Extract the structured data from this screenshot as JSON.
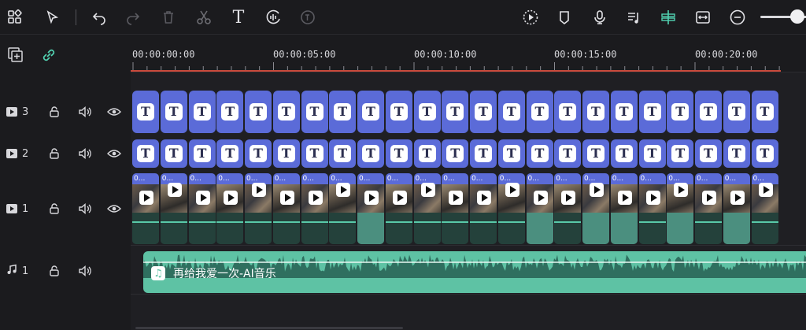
{
  "toolbar": {
    "left_icons": [
      "layout-grid-icon",
      "select-arrow-icon",
      "undo-icon",
      "redo-icon",
      "delete-icon",
      "cut-icon",
      "text-icon",
      "audio-sync-icon",
      "text-to-speech-icon"
    ],
    "right_icons": [
      "render-preview-icon",
      "marker-icon",
      "microphone-icon",
      "audio-mixer-icon",
      "snap-icon",
      "fit-icon",
      "zoom-out-icon"
    ],
    "zoom_level": 0.7
  },
  "timeline": {
    "ruler_labels": [
      "00:00:00:00",
      "00:00:05:00",
      "00:00:10:00",
      "00:00:15:00",
      "00:00:20:00"
    ]
  },
  "tracks": [
    {
      "kind": "video",
      "label": "3"
    },
    {
      "kind": "video",
      "label": "2"
    },
    {
      "kind": "video",
      "label": "1"
    },
    {
      "kind": "audio",
      "label": "1"
    }
  ],
  "title_clip_glyph": "T",
  "video_clip_head": "0...",
  "audio_clip": {
    "title": "再给我爱一次-AI音乐"
  },
  "colors": {
    "accent": "#52d3b2",
    "title_clip": "#5b6bd8",
    "audio_clip": "#5ec2a4",
    "playhead": "#c94a3c"
  }
}
